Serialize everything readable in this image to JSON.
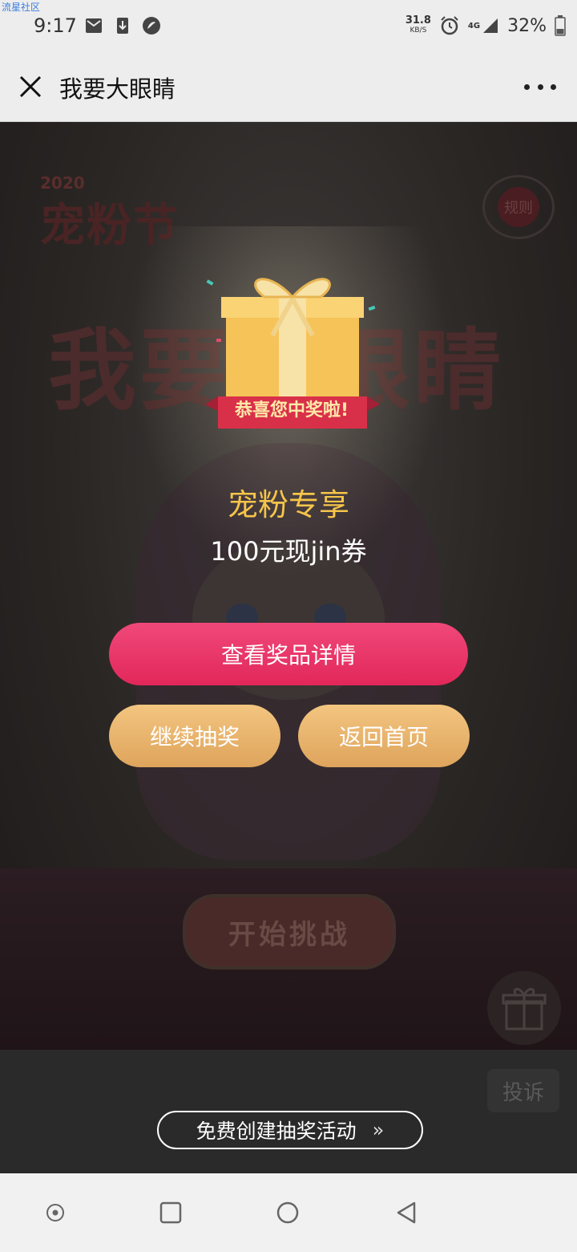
{
  "status_bar": {
    "watermark": "流星社区",
    "time": "9:17",
    "speed_value": "31.8",
    "speed_unit": "KB/S",
    "network": "4G",
    "battery": "32%"
  },
  "title_bar": {
    "title": "我要大眼睛"
  },
  "background": {
    "year": "2020",
    "festival": "宠粉节",
    "rules": "规则",
    "big_title": "我要大眼睛",
    "start_button": "开始挑战"
  },
  "prize": {
    "banner": "恭喜您中奖啦!",
    "title": "宠粉专享",
    "description": "100元现jin券"
  },
  "buttons": {
    "view_details": "查看奖品详情",
    "continue_draw": "继续抽奖",
    "back_home": "返回首页"
  },
  "footer": {
    "report": "投诉",
    "create_activity": "免费创建抽奖活动",
    "create_arrow": "»"
  },
  "colors": {
    "pink": "#e2275a",
    "gold": "#dea45c",
    "prize_title": "#f5c54a"
  }
}
